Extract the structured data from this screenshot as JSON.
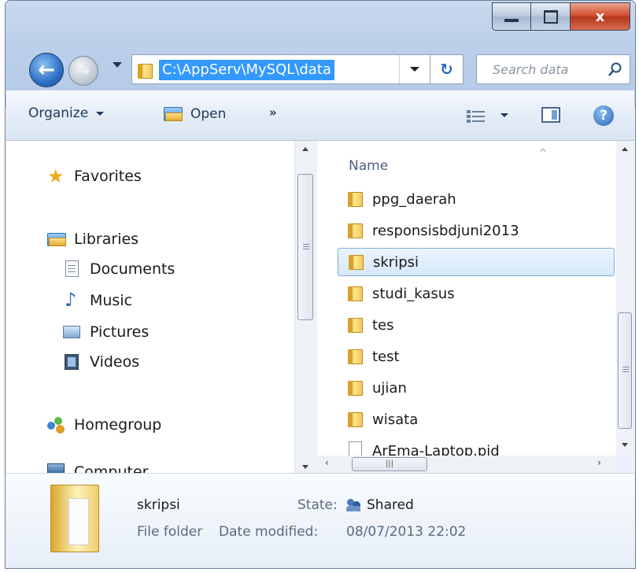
{
  "window": {
    "controls": {
      "minimize": "–",
      "maximize": "□",
      "close": "x"
    }
  },
  "address_bar": {
    "path": "C:\\AppServ\\MySQL\\data"
  },
  "search": {
    "placeholder": "Search data"
  },
  "toolbar": {
    "organize_label": "Organize",
    "open_label": "Open",
    "more_label": "»"
  },
  "nav_pane": {
    "favorites": "Favorites",
    "libraries": "Libraries",
    "library_items": [
      "Documents",
      "Music",
      "Pictures",
      "Videos"
    ],
    "homegroup": "Homegroup",
    "computer": "Computer"
  },
  "file_list": {
    "column_header": "Name",
    "selected_index": 2,
    "items": [
      {
        "name": "ppg_daerah",
        "type": "folder"
      },
      {
        "name": "responsisbdjuni2013",
        "type": "folder"
      },
      {
        "name": "skripsi",
        "type": "folder"
      },
      {
        "name": "studi_kasus",
        "type": "folder"
      },
      {
        "name": "tes",
        "type": "folder"
      },
      {
        "name": "test",
        "type": "folder"
      },
      {
        "name": "ujian",
        "type": "folder"
      },
      {
        "name": "wisata",
        "type": "folder"
      },
      {
        "name": "ArEma-Laptop.pid",
        "type": "file"
      }
    ]
  },
  "details": {
    "name": "skripsi",
    "type": "File folder",
    "state_label": "State:",
    "state_value": "Shared",
    "date_label": "Date modified:",
    "date_value": "08/07/2013 22:02"
  }
}
